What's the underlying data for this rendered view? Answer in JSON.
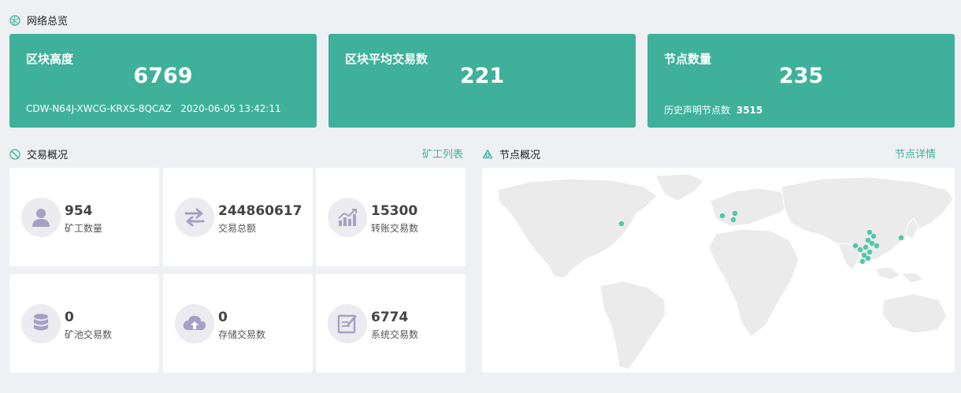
{
  "overview": {
    "title": "网络总览",
    "cards": [
      {
        "label": "区块高度",
        "value": "6769",
        "sub": "CDW-N64J-XWCG-KRXS-8QCAZ   2020-06-05 13:42:11"
      },
      {
        "label": "区块平均交易数",
        "value": "221"
      },
      {
        "label": "节点数量",
        "value": "235",
        "sub_label": "历史声明节点数",
        "sub_value": "3515"
      }
    ]
  },
  "transactions": {
    "title": "交易概况",
    "link": "矿工列表",
    "cards": [
      {
        "value": "954",
        "label": "矿工数量",
        "icon": "user-icon"
      },
      {
        "value": "244860617",
        "label": "交易总额",
        "icon": "exchange-icon"
      },
      {
        "value": "15300",
        "label": "转账交易数",
        "icon": "chart-icon"
      },
      {
        "value": "0",
        "label": "矿池交易数",
        "icon": "database-icon"
      },
      {
        "value": "0",
        "label": "存储交易数",
        "icon": "cloud-upload-icon"
      },
      {
        "value": "6774",
        "label": "系统交易数",
        "icon": "edit-icon"
      }
    ]
  },
  "nodes": {
    "title": "节点概况",
    "link": "节点详情"
  },
  "colors": {
    "accent": "#3fb19a",
    "icon": "#a6a1c4",
    "node_dot": "#4fc8a8",
    "land": "#ebebeb"
  }
}
